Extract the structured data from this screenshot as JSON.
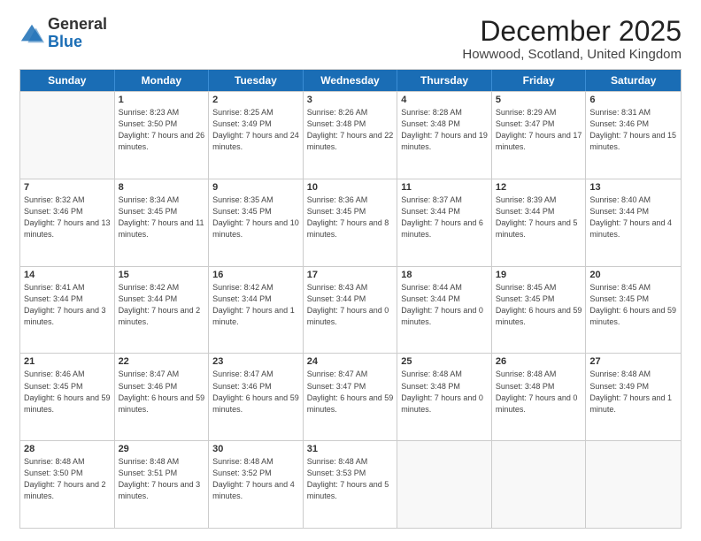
{
  "header": {
    "logo_general": "General",
    "logo_blue": "Blue",
    "title": "December 2025",
    "subtitle": "Howwood, Scotland, United Kingdom"
  },
  "calendar": {
    "days_of_week": [
      "Sunday",
      "Monday",
      "Tuesday",
      "Wednesday",
      "Thursday",
      "Friday",
      "Saturday"
    ],
    "weeks": [
      [
        {
          "day": "",
          "empty": true
        },
        {
          "day": "1",
          "sunrise": "8:23 AM",
          "sunset": "3:50 PM",
          "daylight": "7 hours and 26 minutes."
        },
        {
          "day": "2",
          "sunrise": "8:25 AM",
          "sunset": "3:49 PM",
          "daylight": "7 hours and 24 minutes."
        },
        {
          "day": "3",
          "sunrise": "8:26 AM",
          "sunset": "3:48 PM",
          "daylight": "7 hours and 22 minutes."
        },
        {
          "day": "4",
          "sunrise": "8:28 AM",
          "sunset": "3:48 PM",
          "daylight": "7 hours and 19 minutes."
        },
        {
          "day": "5",
          "sunrise": "8:29 AM",
          "sunset": "3:47 PM",
          "daylight": "7 hours and 17 minutes."
        },
        {
          "day": "6",
          "sunrise": "8:31 AM",
          "sunset": "3:46 PM",
          "daylight": "7 hours and 15 minutes."
        }
      ],
      [
        {
          "day": "7",
          "sunrise": "8:32 AM",
          "sunset": "3:46 PM",
          "daylight": "7 hours and 13 minutes."
        },
        {
          "day": "8",
          "sunrise": "8:34 AM",
          "sunset": "3:45 PM",
          "daylight": "7 hours and 11 minutes."
        },
        {
          "day": "9",
          "sunrise": "8:35 AM",
          "sunset": "3:45 PM",
          "daylight": "7 hours and 10 minutes."
        },
        {
          "day": "10",
          "sunrise": "8:36 AM",
          "sunset": "3:45 PM",
          "daylight": "7 hours and 8 minutes."
        },
        {
          "day": "11",
          "sunrise": "8:37 AM",
          "sunset": "3:44 PM",
          "daylight": "7 hours and 6 minutes."
        },
        {
          "day": "12",
          "sunrise": "8:39 AM",
          "sunset": "3:44 PM",
          "daylight": "7 hours and 5 minutes."
        },
        {
          "day": "13",
          "sunrise": "8:40 AM",
          "sunset": "3:44 PM",
          "daylight": "7 hours and 4 minutes."
        }
      ],
      [
        {
          "day": "14",
          "sunrise": "8:41 AM",
          "sunset": "3:44 PM",
          "daylight": "7 hours and 3 minutes."
        },
        {
          "day": "15",
          "sunrise": "8:42 AM",
          "sunset": "3:44 PM",
          "daylight": "7 hours and 2 minutes."
        },
        {
          "day": "16",
          "sunrise": "8:42 AM",
          "sunset": "3:44 PM",
          "daylight": "7 hours and 1 minute."
        },
        {
          "day": "17",
          "sunrise": "8:43 AM",
          "sunset": "3:44 PM",
          "daylight": "7 hours and 0 minutes."
        },
        {
          "day": "18",
          "sunrise": "8:44 AM",
          "sunset": "3:44 PM",
          "daylight": "7 hours and 0 minutes."
        },
        {
          "day": "19",
          "sunrise": "8:45 AM",
          "sunset": "3:45 PM",
          "daylight": "6 hours and 59 minutes."
        },
        {
          "day": "20",
          "sunrise": "8:45 AM",
          "sunset": "3:45 PM",
          "daylight": "6 hours and 59 minutes."
        }
      ],
      [
        {
          "day": "21",
          "sunrise": "8:46 AM",
          "sunset": "3:45 PM",
          "daylight": "6 hours and 59 minutes."
        },
        {
          "day": "22",
          "sunrise": "8:47 AM",
          "sunset": "3:46 PM",
          "daylight": "6 hours and 59 minutes."
        },
        {
          "day": "23",
          "sunrise": "8:47 AM",
          "sunset": "3:46 PM",
          "daylight": "6 hours and 59 minutes."
        },
        {
          "day": "24",
          "sunrise": "8:47 AM",
          "sunset": "3:47 PM",
          "daylight": "6 hours and 59 minutes."
        },
        {
          "day": "25",
          "sunrise": "8:48 AM",
          "sunset": "3:48 PM",
          "daylight": "7 hours and 0 minutes."
        },
        {
          "day": "26",
          "sunrise": "8:48 AM",
          "sunset": "3:48 PM",
          "daylight": "7 hours and 0 minutes."
        },
        {
          "day": "27",
          "sunrise": "8:48 AM",
          "sunset": "3:49 PM",
          "daylight": "7 hours and 1 minute."
        }
      ],
      [
        {
          "day": "28",
          "sunrise": "8:48 AM",
          "sunset": "3:50 PM",
          "daylight": "7 hours and 2 minutes."
        },
        {
          "day": "29",
          "sunrise": "8:48 AM",
          "sunset": "3:51 PM",
          "daylight": "7 hours and 3 minutes."
        },
        {
          "day": "30",
          "sunrise": "8:48 AM",
          "sunset": "3:52 PM",
          "daylight": "7 hours and 4 minutes."
        },
        {
          "day": "31",
          "sunrise": "8:48 AM",
          "sunset": "3:53 PM",
          "daylight": "7 hours and 5 minutes."
        },
        {
          "day": "",
          "empty": true
        },
        {
          "day": "",
          "empty": true
        },
        {
          "day": "",
          "empty": true
        }
      ]
    ]
  }
}
